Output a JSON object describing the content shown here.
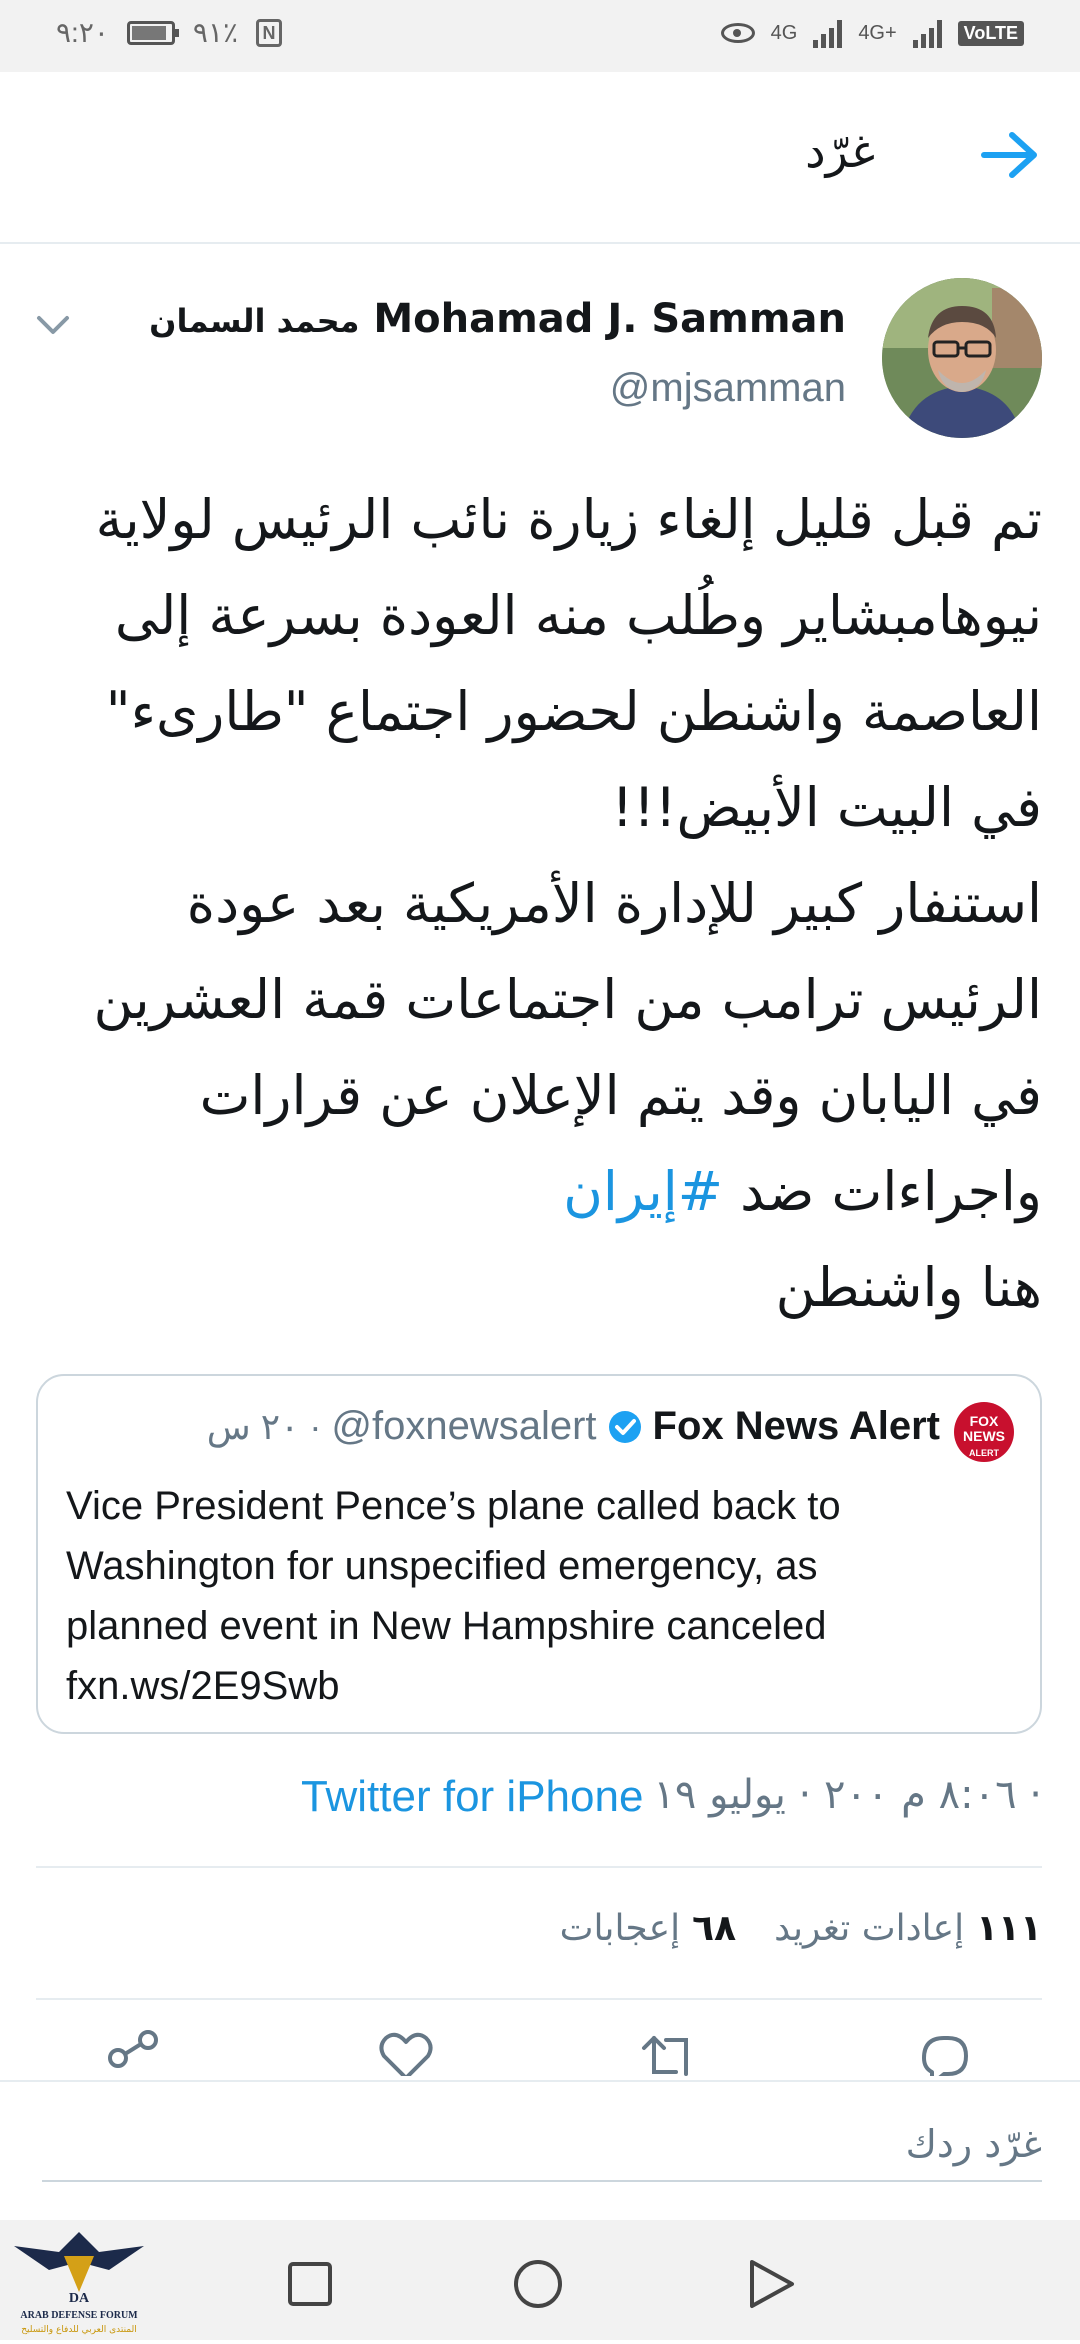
{
  "status_bar": {
    "time": "٩:٢٠",
    "battery_percent": "٩١٪",
    "battery_level": 0.91,
    "network_1": "4G",
    "network_2": "4G+",
    "volte": "VoLTE"
  },
  "header": {
    "title": "غرّد",
    "back_icon": "arrow-right-icon"
  },
  "tweet": {
    "author_name_en": "Mohamad J. Samman",
    "author_name_ar": "محمد السمان",
    "handle": "@mjsamman",
    "body_part1": "تم قبل قليل إلغاء زيارة نائب الرئيس لولاية\nنيوهامبشاير وطُلب منه العودة بسرعة إلى\nالعاصمة واشنطن لحضور اجتماع \"طارىء\"\nفي البيت الأبيض!!!\nاستنفار كبير للإدارة الأمريكية بعد عودة\nالرئيس ترامب من اجتماعات قمة العشرين\nفي اليابان وقد يتم الإعلان عن قرارات\nواجراءات ضد ",
    "hashtag": "#إيران",
    "body_part2": "\nهنا واشنطن",
    "quoted": {
      "name": "Fox News Alert",
      "handle": "@foxnewsalert",
      "time": "٢٠ س",
      "logo_text": "FOX NEWS ALERT",
      "text": "Vice President Pence’s plane called back to\nWashington for unspecified emergency, as\nplanned event in New Hampshire canceled\nfxn.ws/2E9Swb"
    },
    "timestamp": "٨:٠٦ م ٢٠٠ · يوليو ١٩ ·",
    "source": "Twitter for iPhone",
    "retweets_count": "١١١",
    "retweets_label": "إعادات تغريد",
    "likes_count": "٦٨",
    "likes_label": "إعجابات"
  },
  "actions": [
    "share-icon",
    "like-icon",
    "retweet-icon",
    "reply-icon"
  ],
  "reply": {
    "placeholder": "غرّد ردك"
  },
  "navbar": {
    "items": [
      "recent-apps-icon",
      "home-icon",
      "back-icon"
    ]
  },
  "watermark": {
    "text": "ARAB DEFENSE FORUM",
    "text_ar": "المنتدى العربي للدفاع والتسليح",
    "short": "DA"
  },
  "colors": {
    "accent": "#1da1f2",
    "link": "#1b95e0",
    "muted": "#657786",
    "fox_red": "#c8102e"
  }
}
